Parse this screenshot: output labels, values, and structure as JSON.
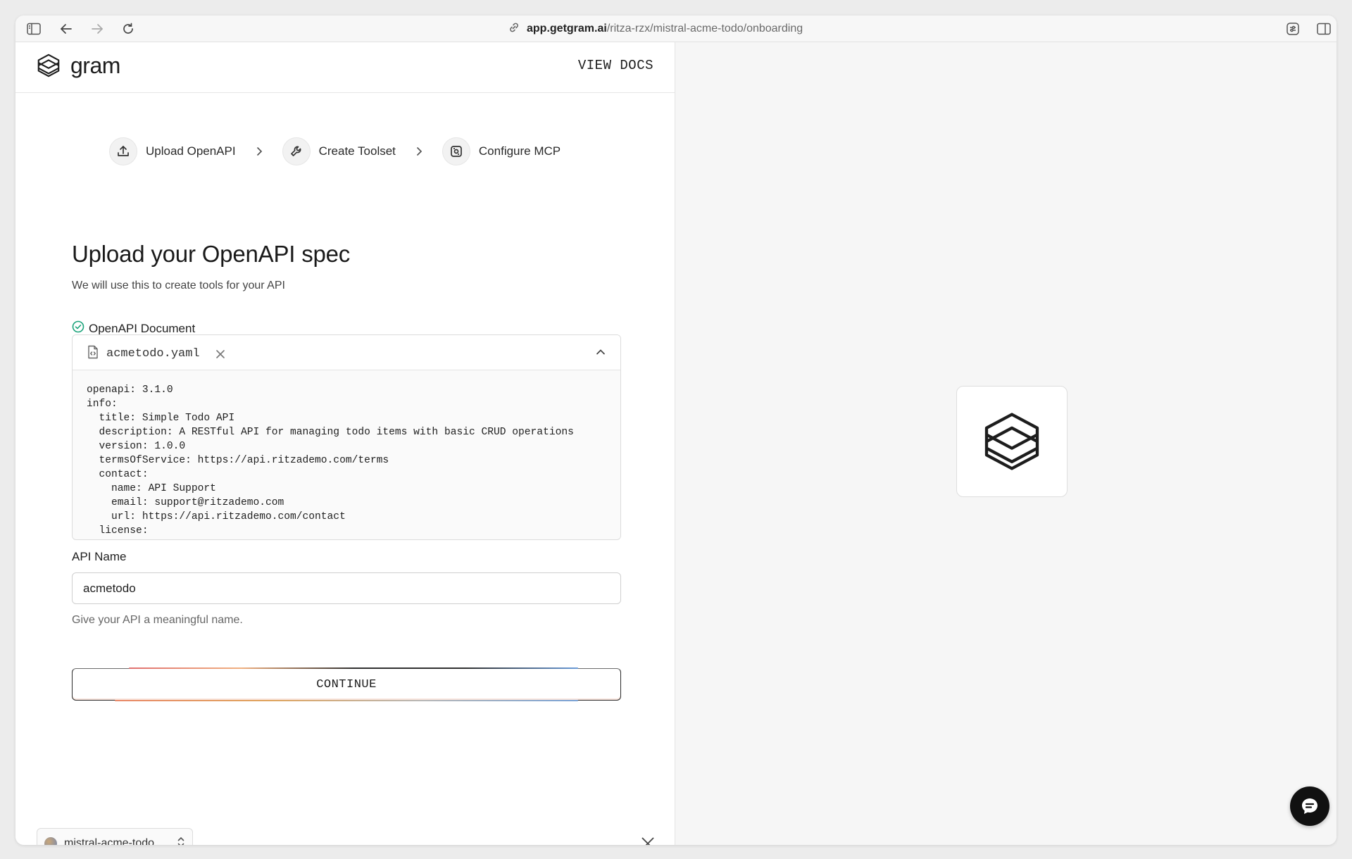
{
  "browser": {
    "url_host": "app.getgram.ai",
    "url_path": "/ritza-rzx/mistral-acme-todo/onboarding"
  },
  "header": {
    "logo_text": "gram",
    "view_docs_label": "VIEW DOCS"
  },
  "stepper": {
    "steps": [
      {
        "label": "Upload OpenAPI",
        "icon": "upload-icon"
      },
      {
        "label": "Create Toolset",
        "icon": "wrench-icon"
      },
      {
        "label": "Configure MCP",
        "icon": "server-icon"
      }
    ]
  },
  "main": {
    "title": "Upload your OpenAPI spec",
    "subtitle": "We will use this to create tools for your API",
    "document_label": "OpenAPI Document",
    "file_name": "acmetodo.yaml",
    "code": "openapi: 3.1.0\ninfo:\n  title: Simple Todo API\n  description: A RESTful API for managing todo items with basic CRUD operations\n  version: 1.0.0\n  termsOfService: https://api.ritzademo.com/terms\n  contact:\n    name: API Support\n    email: support@ritzademo.com\n    url: https://api.ritzademo.com/contact\n  license:",
    "api_name_label": "API Name",
    "api_name_value": "acmetodo",
    "api_name_hint": "Give your API a meaningful name.",
    "continue_label": "CONTINUE"
  },
  "footer": {
    "project_name": "mistral-acme-todo"
  },
  "colors": {
    "success": "#1aa37a",
    "accent_dark": "#111111"
  }
}
